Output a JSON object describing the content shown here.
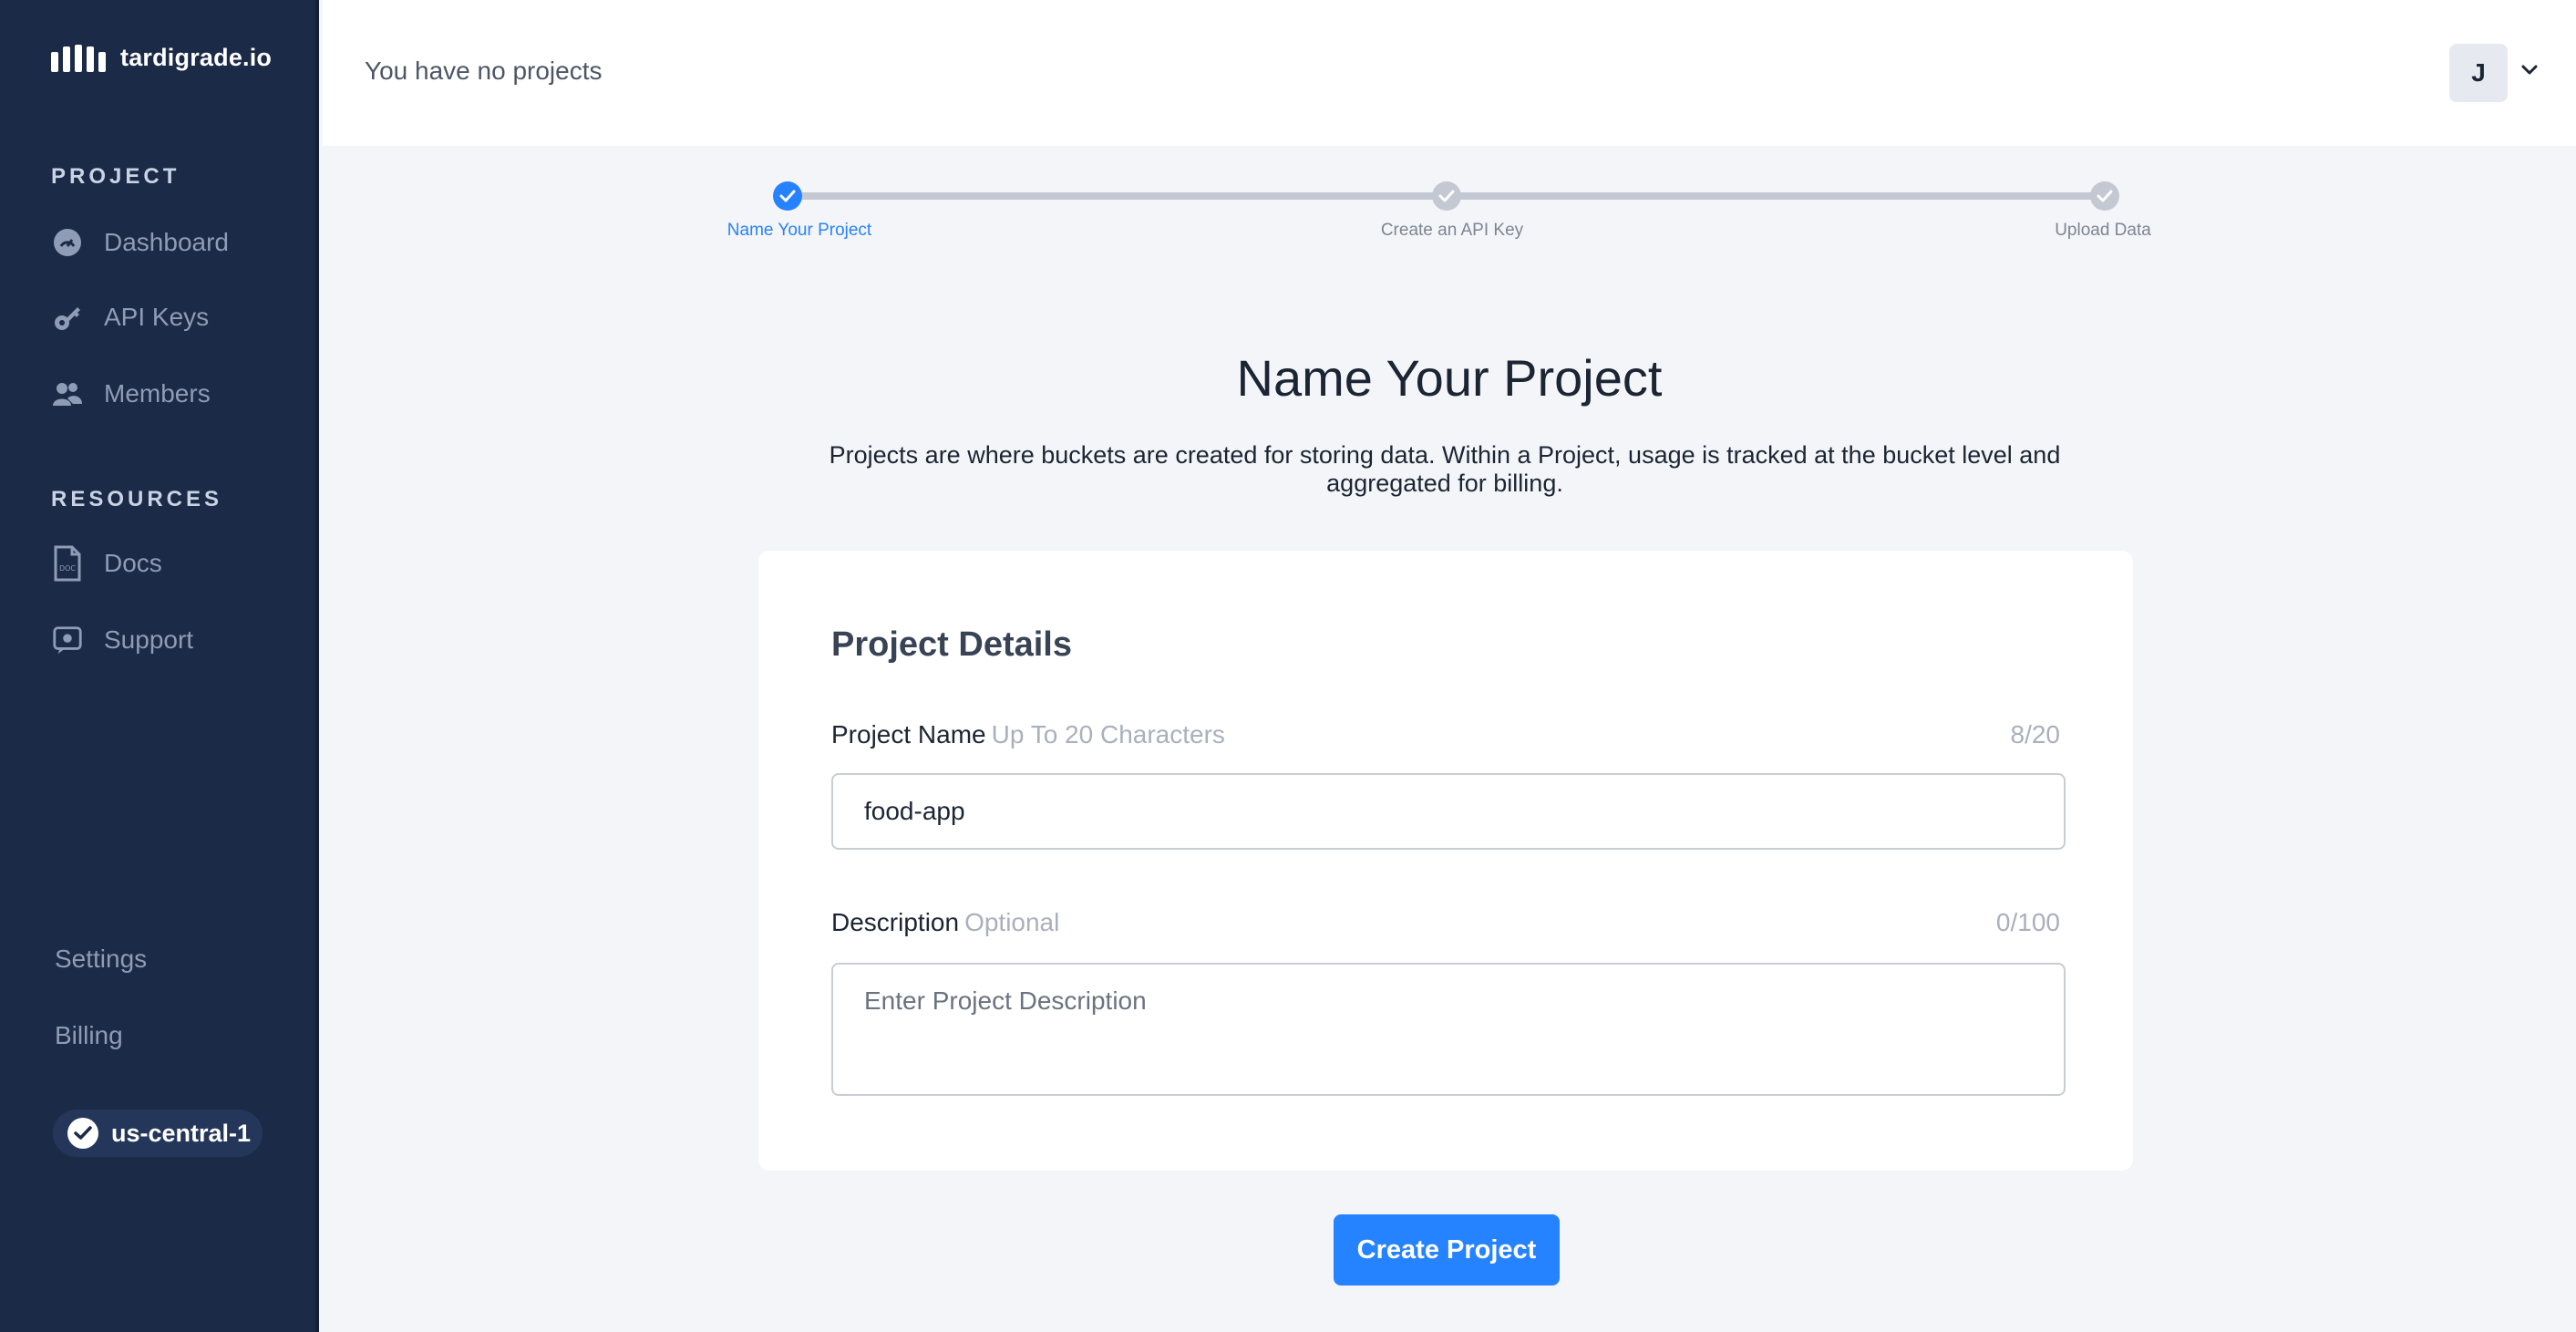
{
  "sidebar": {
    "logo_text": "tardigrade.io",
    "sections": {
      "project_title": "PROJECT",
      "resources_title": "RESOURCES"
    },
    "project_items": [
      {
        "label": "Dashboard",
        "icon": "dashboard-icon"
      },
      {
        "label": "API Keys",
        "icon": "key-icon"
      },
      {
        "label": "Members",
        "icon": "members-icon"
      }
    ],
    "resource_items": [
      {
        "label": "Docs",
        "icon": "doc-icon"
      },
      {
        "label": "Support",
        "icon": "support-icon"
      }
    ],
    "bottom_links": {
      "settings": "Settings",
      "billing": "Billing"
    },
    "region": {
      "label": "us-central-1",
      "icon": "check-circle-icon"
    }
  },
  "header": {
    "title": "You have no projects",
    "avatar_initial": "J",
    "dropdown_icon": "chevron-down-icon"
  },
  "progress": {
    "steps": [
      {
        "label": "Name Your Project",
        "state": "active"
      },
      {
        "label": "Create an API Key",
        "state": "inactive"
      },
      {
        "label": "Upload Data",
        "state": "inactive"
      }
    ]
  },
  "main": {
    "title": "Name Your Project",
    "description": "Projects are where buckets are created for storing data. Within a Project, usage is tracked at the bucket level and aggregated for billing."
  },
  "form": {
    "card_title": "Project Details",
    "project_name": {
      "label": "Project Name",
      "hint": "Up To 20 Characters",
      "count": "8/20",
      "value": "food-app"
    },
    "description": {
      "label": "Description",
      "hint": "Optional",
      "count": "0/100",
      "placeholder": "Enter Project Description",
      "value": ""
    },
    "submit_label": "Create Project"
  },
  "colors": {
    "sidebar_bg": "#1b2a47",
    "accent": "#2683ff",
    "page_bg": "#f4f5f8"
  }
}
